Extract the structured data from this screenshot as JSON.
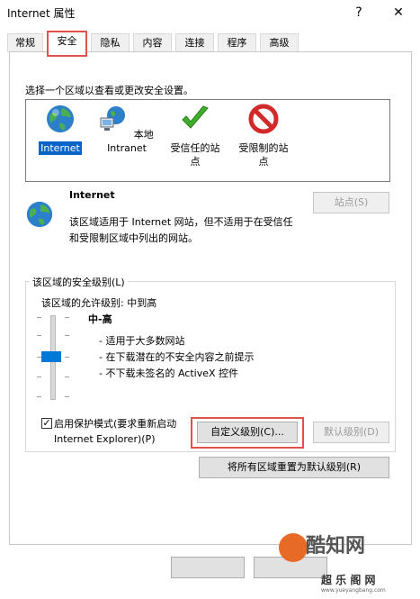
{
  "window": {
    "title": "Internet 属性",
    "help": "?",
    "close": "✕"
  },
  "tabs": [
    "常规",
    "安全",
    "隐私",
    "内容",
    "连接",
    "程序",
    "高级"
  ],
  "active_tab": "安全",
  "zone_prompt": "选择一个区域以查看或更改安全设置。",
  "zones": [
    {
      "l1": "Internet",
      "l2": "",
      "icon": "globe-icon"
    },
    {
      "l1": "本地",
      "l2": "Intranet",
      "icon": "intranet-icon"
    },
    {
      "l1": "受信任的站",
      "l2": "点",
      "icon": "checkmark-icon"
    },
    {
      "l1": "受限制的站",
      "l2": "点",
      "icon": "restricted-icon"
    }
  ],
  "selected_zone": {
    "name": "Internet",
    "desc1": "该区域适用于 Internet 网站，但不适用于在受信任",
    "desc2": "和受限制区域中列出的网站。",
    "sites_button": "站点(S)"
  },
  "security_level": {
    "group_title": "该区域的安全级别(L)",
    "allowed": "该区域的允许级别: 中到高",
    "level": "中-高",
    "items": [
      "- 适用于大多数网站",
      "- 在下载潜在的不安全内容之前提示",
      "- 不下载未签名的 ActiveX 控件"
    ]
  },
  "protected_mode": {
    "line1": "启用保护模式(要求重新启动",
    "line2": "Internet Explorer)(P)",
    "checked": "✓"
  },
  "buttons": {
    "custom": "自定义级别(C)...",
    "default": "默认级别(D)",
    "reset_all": "将所有区域重置为默认级别(R)"
  },
  "watermark": {
    "brand": "酷知网",
    "sub": "超 乐 阁 网",
    "url": "www.yueyangbang.com"
  },
  "colors": {
    "highlight": "#e0524b",
    "selection": "#0a64c8",
    "accent": "#0078d7"
  }
}
